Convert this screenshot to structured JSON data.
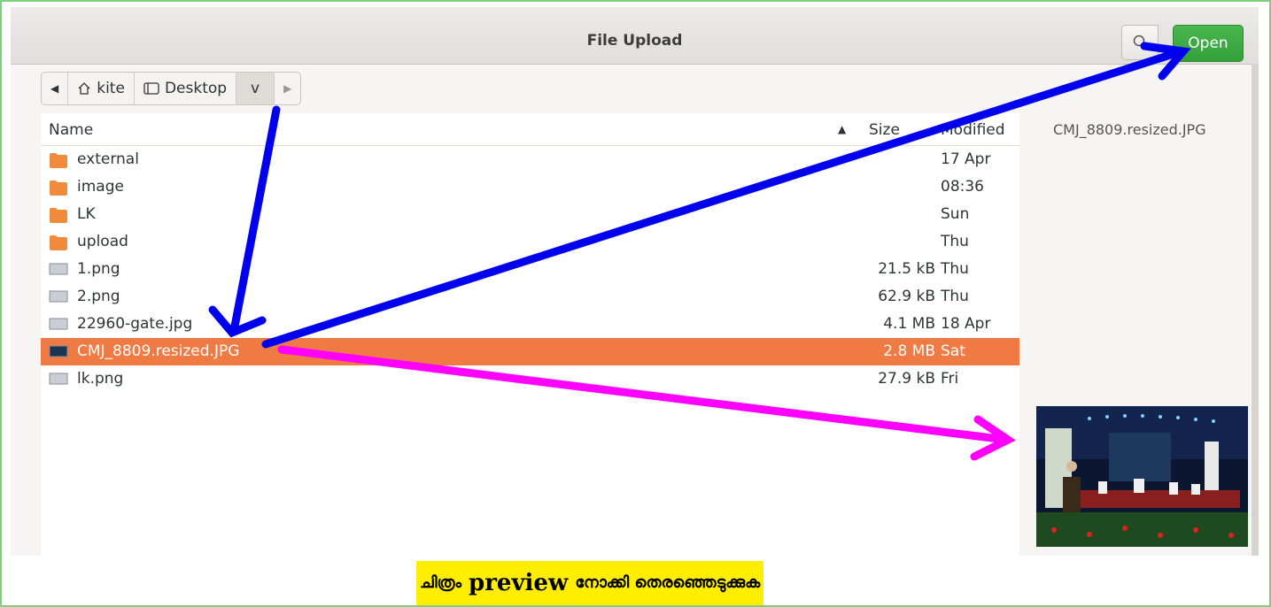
{
  "window": {
    "title": "File Upload",
    "open_label": "Open"
  },
  "pathbar": {
    "crumbs": [
      "kite",
      "Desktop",
      "v"
    ]
  },
  "columns": {
    "name": "Name",
    "size": "Size",
    "modified": "Modified"
  },
  "files": [
    {
      "name": "external",
      "size": "",
      "modified": "17 Apr",
      "kind": "folder-icon"
    },
    {
      "name": "image",
      "size": "",
      "modified": "08:36",
      "kind": "folder-icon"
    },
    {
      "name": "LK",
      "size": "",
      "modified": "Sun",
      "kind": "folder-icon"
    },
    {
      "name": "upload",
      "size": "",
      "modified": "Thu",
      "kind": "folder-icon"
    },
    {
      "name": "1.png",
      "size": "21.5 kB",
      "modified": "Thu",
      "kind": "image-thumb-icon"
    },
    {
      "name": "2.png",
      "size": "62.9 kB",
      "modified": "Thu",
      "kind": "image-thumb-icon"
    },
    {
      "name": "22960-gate.jpg",
      "size": "4.1 MB",
      "modified": "18 Apr",
      "kind": "image-thumb-icon"
    },
    {
      "name": "CMJ_8809.resized.JPG",
      "size": "2.8 MB",
      "modified": "Sat",
      "kind": "image-thumb-icon",
      "selected": true
    },
    {
      "name": "lk.png",
      "size": "27.9 kB",
      "modified": "Fri",
      "kind": "image-thumb-icon"
    }
  ],
  "preview": {
    "filename": "CMJ_8809.resized.JPG"
  },
  "caption": {
    "part1": "ചിത്രം",
    "part2": "preview",
    "part3": "നോക്കി തെരഞ്ഞെടുക്കുക"
  },
  "colors": {
    "selection": "#ef7a43",
    "open_button": "#3aa63f",
    "arrow_blue": "#0000ee",
    "arrow_magenta": "#ff00ff",
    "caption_highlight": "#ffee00"
  }
}
